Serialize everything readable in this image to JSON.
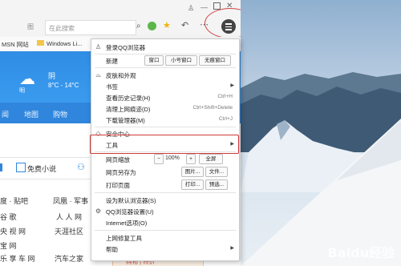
{
  "browser": {
    "search_placeholder": "在此搜索",
    "search_prefix": "图",
    "bookmarks": [
      "MSN 网站",
      "Windows Li..."
    ],
    "weather": {
      "city_suffix": "明",
      "condition": "阴",
      "temp": "8°C - 14°C"
    },
    "nav_items": [
      "闻",
      "地图",
      "购物"
    ],
    "novel_label": "免费小说",
    "sites_left": [
      "度 · 贴吧",
      "谷 歌",
      "央 视 网",
      "宝 网",
      "乐 享 车 网"
    ],
    "sites_right": [
      "凤凰 · 军事",
      "人 人 网",
      "天涯社区",
      "",
      "汽车之家"
    ],
    "ad_text": "购物 | 特价"
  },
  "menu": {
    "login": "登录QQ浏览器",
    "new_label": "新建",
    "new_window": "窗口",
    "new_small": "小号窗口",
    "new_private": "无痕窗口",
    "skin": "皮肤和外观",
    "bookmarks": "书签",
    "history": "查看历史记录(H)",
    "history_sc": "Ctrl+H",
    "clear": "清理上网痕迹(D)",
    "clear_sc": "Ctrl+Shift+Delete",
    "downloads": "下载管理器(M)",
    "downloads_sc": "Ctrl+J",
    "security": "安全中心",
    "tools": "工具",
    "zoom_label": "网页缩放",
    "zoom_minus": "−",
    "zoom_value": "100%",
    "zoom_plus": "+",
    "fullscreen": "全屏",
    "save_as": "网页另存为",
    "save_image": "图片...",
    "save_file": "文件...",
    "print": "打印页面",
    "print_btn": "打印...",
    "preview_btn": "预选...",
    "default_browser": "设为默认浏览器(S)",
    "settings": "QQ浏览器设置(U)",
    "internet_options": "Internet选项(O)",
    "repair": "上网修复工具",
    "help": "帮助"
  },
  "watermark": "Baidu经验"
}
